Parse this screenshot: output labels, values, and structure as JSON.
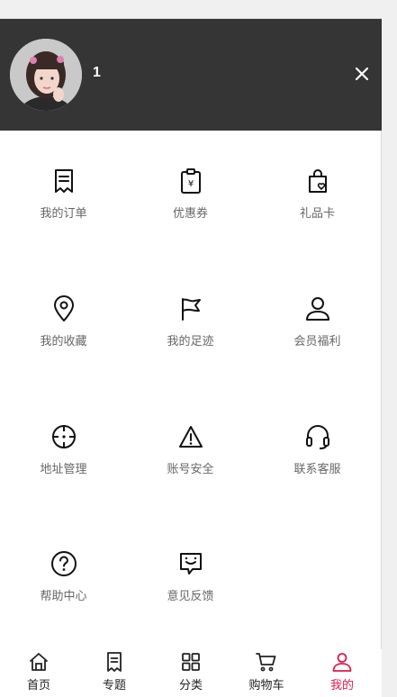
{
  "header": {
    "username": "1",
    "avatar_icon": "user-avatar-photo",
    "close_icon": "close-icon"
  },
  "menu": [
    {
      "id": "orders",
      "label": "我的订单",
      "icon": "receipt-icon"
    },
    {
      "id": "coupons",
      "label": "优惠券",
      "icon": "coupon-icon"
    },
    {
      "id": "giftcard",
      "label": "礼品卡",
      "icon": "gift-bag-icon"
    },
    {
      "id": "favorites",
      "label": "我的收藏",
      "icon": "location-pin-icon"
    },
    {
      "id": "footprints",
      "label": "我的足迹",
      "icon": "flag-icon"
    },
    {
      "id": "member",
      "label": "会员福利",
      "icon": "person-icon"
    },
    {
      "id": "address",
      "label": "地址管理",
      "icon": "crosshair-icon"
    },
    {
      "id": "security",
      "label": "账号安全",
      "icon": "warning-icon"
    },
    {
      "id": "service",
      "label": "联系客服",
      "icon": "headset-icon"
    },
    {
      "id": "help",
      "label": "帮助中心",
      "icon": "help-icon"
    },
    {
      "id": "feedback",
      "label": "意见反馈",
      "icon": "feedback-icon"
    }
  ],
  "tabbar": [
    {
      "id": "home",
      "label": "首页",
      "icon": "home-icon",
      "active": false
    },
    {
      "id": "topic",
      "label": "专题",
      "icon": "bookmark-icon",
      "active": false
    },
    {
      "id": "category",
      "label": "分类",
      "icon": "category-icon",
      "active": false
    },
    {
      "id": "cart",
      "label": "购物车",
      "icon": "cart-icon",
      "active": false
    },
    {
      "id": "mine",
      "label": "我的",
      "icon": "profile-icon",
      "active": true
    }
  ],
  "colors": {
    "header_bg": "#353535",
    "active_tab": "#e0194a",
    "label_gray": "#666666"
  }
}
